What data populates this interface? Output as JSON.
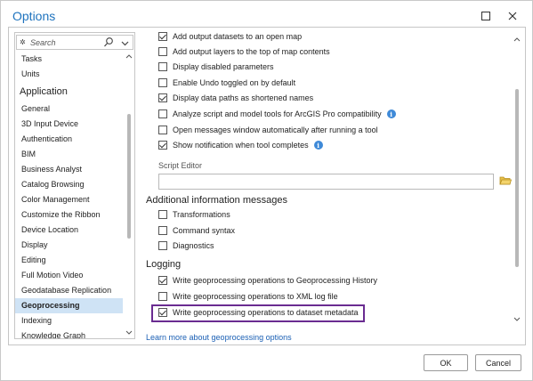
{
  "window": {
    "title": "Options",
    "minimize_glyph": "☐",
    "close_glyph": "✕"
  },
  "search": {
    "placeholder": "Search"
  },
  "sidebar": {
    "items_before": [
      "Tasks",
      "Units"
    ],
    "group_header": "Application",
    "items": [
      "General",
      "3D Input Device",
      "Authentication",
      "BIM",
      "Business Analyst",
      "Catalog Browsing",
      "Color Management",
      "Customize the Ribbon",
      "Device Location",
      "Display",
      "Editing",
      "Full Motion Video",
      "Geodatabase Replication",
      "Geoprocessing",
      "Indexing",
      "Knowledge Graph"
    ],
    "selected": "Geoprocessing"
  },
  "general_options": [
    {
      "label": "Add output datasets to an open map",
      "checked": true,
      "info": false
    },
    {
      "label": "Add output layers to the top of map contents",
      "checked": false,
      "info": false
    },
    {
      "label": "Display disabled parameters",
      "checked": false,
      "info": false
    },
    {
      "label": "Enable Undo toggled on by default",
      "checked": false,
      "info": false
    },
    {
      "label": "Display data paths as shortened names",
      "checked": true,
      "info": false
    },
    {
      "label": "Analyze script and model tools for ArcGIS Pro compatibility",
      "checked": false,
      "info": true
    },
    {
      "label": "Open messages window automatically after running a tool",
      "checked": false,
      "info": false
    },
    {
      "label": "Show notification when tool completes",
      "checked": true,
      "info": true
    }
  ],
  "script_editor": {
    "label": "Script Editor",
    "value": ""
  },
  "additional_messages": {
    "header": "Additional information messages",
    "options": [
      {
        "label": "Transformations",
        "checked": false
      },
      {
        "label": "Command syntax",
        "checked": false
      },
      {
        "label": "Diagnostics",
        "checked": false
      }
    ]
  },
  "logging": {
    "header": "Logging",
    "options": [
      {
        "label": "Write geoprocessing operations to Geoprocessing History",
        "checked": true
      },
      {
        "label": "Write geoprocessing operations to XML log file",
        "checked": false
      },
      {
        "label": "Write geoprocessing operations to dataset metadata",
        "checked": true
      }
    ]
  },
  "learn_more": "Learn more about geoprocessing options",
  "footer": {
    "ok": "OK",
    "cancel": "Cancel"
  },
  "colors": {
    "accent": "#1e73be",
    "selection": "#cfe3f5",
    "highlight_border": "#6a2c91",
    "link": "#1a5fb4"
  }
}
